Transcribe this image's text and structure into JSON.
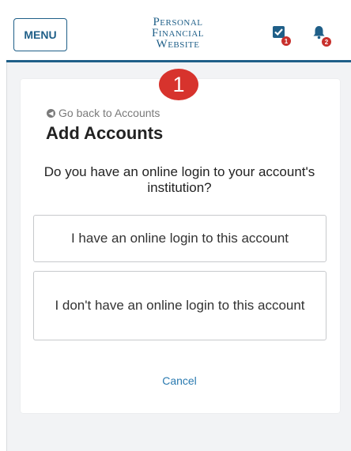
{
  "header": {
    "menu_label": "MENU",
    "logo_line1": "Personal",
    "logo_line2": "Financial",
    "logo_line3": "Website",
    "tasks_badge": "1",
    "notifications_badge": "2",
    "accent_color": "#1f5f88",
    "badge_color": "#c8302c"
  },
  "step_marker": "1",
  "page": {
    "back_link": "Go back to Accounts",
    "title": "Add Accounts",
    "question": "Do you have an online login to your account's institution?",
    "option_yes": "I have an online login to this account",
    "option_no": "I don't have an online login to this account",
    "cancel": "Cancel"
  }
}
